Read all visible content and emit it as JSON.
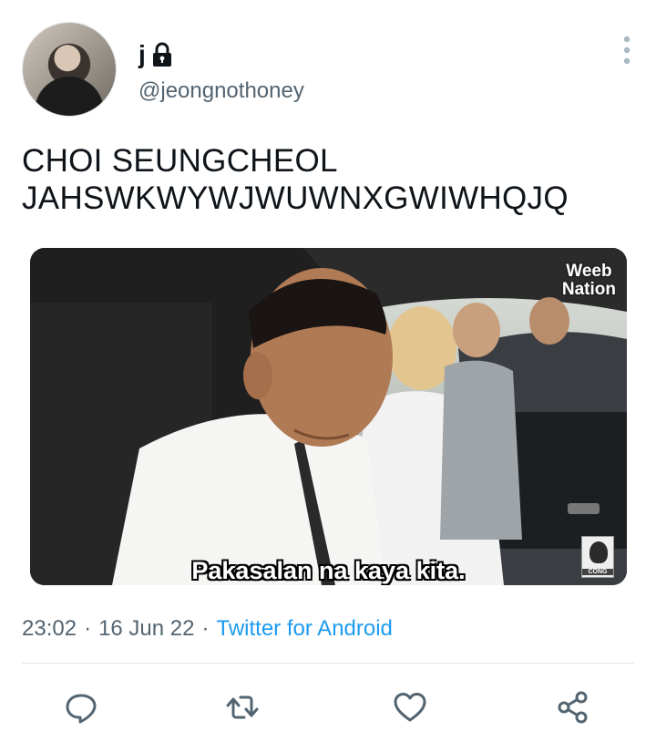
{
  "tweet": {
    "display_name": "j",
    "handle": "@jeongnothoney",
    "protected_icon": "lock-icon",
    "text_lines": [
      "CHOI SEUNGCHEOL",
      "JAHSWKWYWJWUWNXGWIWHQJQ"
    ],
    "media": {
      "watermark_line1": "Weeb",
      "watermark_line2": "Nation",
      "subtitle": "Pakasalan na kaya kita.",
      "channel_tag": "CONG"
    },
    "time": "23:02",
    "date": "16 Jun 22",
    "source": "Twitter for Android",
    "separator": "·"
  },
  "actions": [
    {
      "name": "reply",
      "icon": "reply-icon"
    },
    {
      "name": "retweet",
      "icon": "retweet-icon"
    },
    {
      "name": "like",
      "icon": "heart-icon"
    },
    {
      "name": "share",
      "icon": "share-icon"
    }
  ],
  "colors": {
    "text": "#0f1419",
    "secondary": "#536471",
    "link": "#1d9bf0",
    "divider": "#e1e8ed"
  }
}
